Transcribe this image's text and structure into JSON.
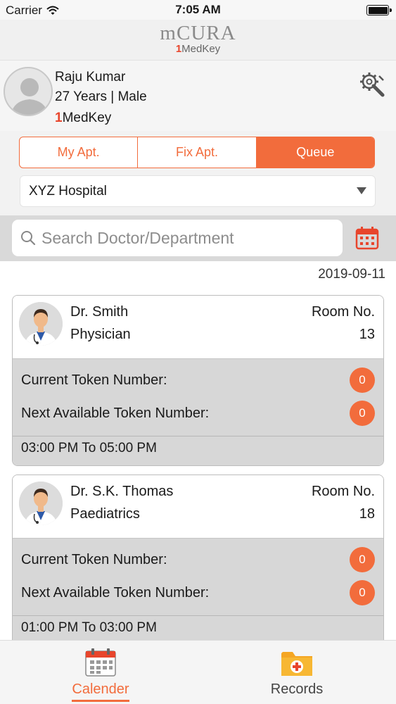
{
  "status_bar": {
    "carrier": "Carrier",
    "time": "7:05 AM"
  },
  "header": {
    "brand": "mCURA",
    "sub_one": "1",
    "sub_rest": "MedKey"
  },
  "profile": {
    "name": "Raju Kumar",
    "age_gender": "27 Years | Male",
    "key_one": "1",
    "key_rest": "MedKey"
  },
  "tabs": {
    "my_apt": "My Apt.",
    "fix_apt": "Fix Apt.",
    "queue": "Queue",
    "active": "Queue"
  },
  "hospital": {
    "selected": "XYZ Hospital"
  },
  "search": {
    "placeholder": "Search Doctor/Department"
  },
  "list": {
    "date": "2019-09-11",
    "doctors": [
      {
        "name": "Dr. Smith",
        "specialty": "Physician",
        "room_label": "Room No.",
        "room_no": "13",
        "current_label": "Current Token Number:",
        "current_value": "0",
        "next_label": "Next Available Token Number:",
        "next_value": "0",
        "time": "03:00 PM To 05:00 PM"
      },
      {
        "name": "Dr. S.K. Thomas",
        "specialty": "Paediatrics",
        "room_label": "Room No.",
        "room_no": "18",
        "current_label": "Current Token Number:",
        "current_value": "0",
        "next_label": "Next Available Token Number:",
        "next_value": "0",
        "time": "01:00 PM To 03:00 PM"
      }
    ]
  },
  "bottom_nav": {
    "calender": "Calender",
    "records": "Records",
    "active": "Calender"
  },
  "colors": {
    "accent": "#f26c3c",
    "brand_red": "#e8452c"
  }
}
